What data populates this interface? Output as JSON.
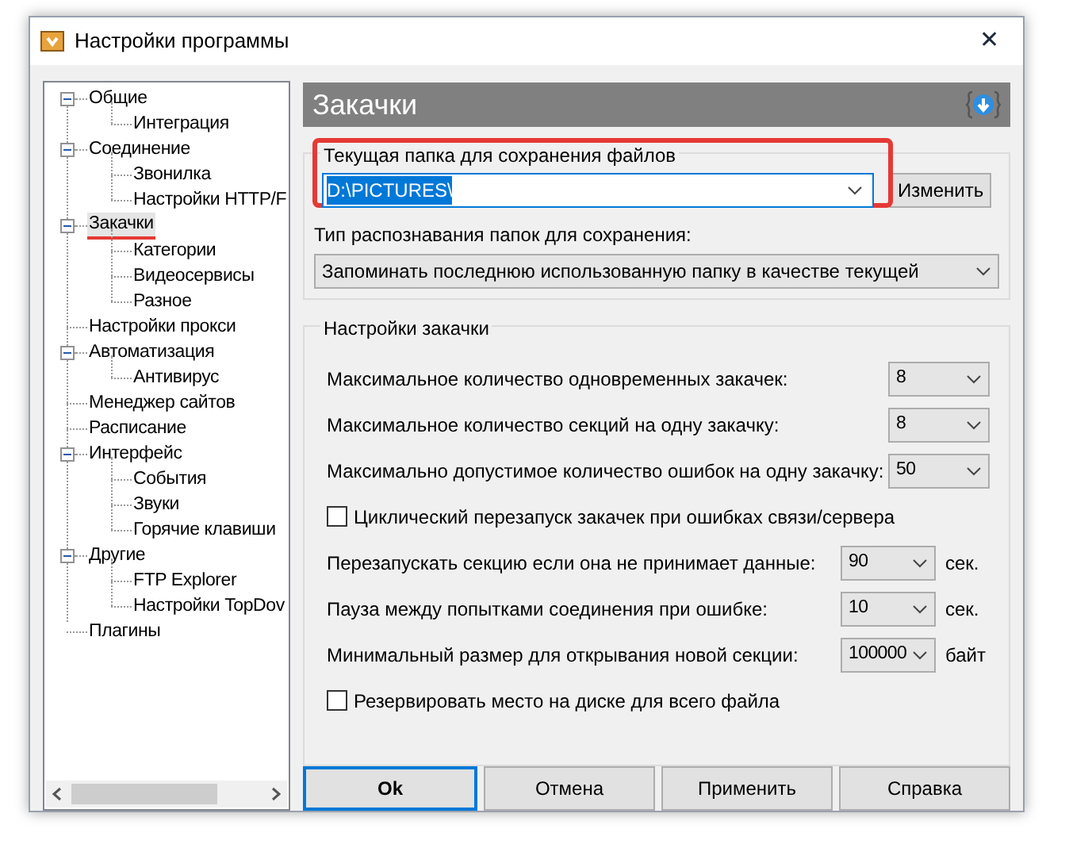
{
  "window": {
    "title": "Настройки программы",
    "close": "✕"
  },
  "tree": [
    {
      "label": "Общие",
      "selected": false,
      "expanded": true,
      "children": [
        {
          "label": "Интеграция",
          "selected": false
        }
      ]
    },
    {
      "label": "Соединение",
      "selected": false,
      "expanded": true,
      "children": [
        {
          "label": "Звонилка",
          "selected": false
        },
        {
          "label": "Настройки HTTP/F",
          "selected": false
        }
      ]
    },
    {
      "label": "Закачки",
      "selected": true,
      "expanded": true,
      "children": [
        {
          "label": "Категории",
          "selected": false
        },
        {
          "label": "Видеосервисы",
          "selected": false
        },
        {
          "label": "Разное",
          "selected": false
        }
      ]
    },
    {
      "label": "Настройки прокси",
      "selected": false
    },
    {
      "label": "Автоматизация",
      "selected": false,
      "expanded": true,
      "children": [
        {
          "label": "Антивирус",
          "selected": false
        }
      ]
    },
    {
      "label": "Менеджер сайтов",
      "selected": false
    },
    {
      "label": "Расписание",
      "selected": false
    },
    {
      "label": "Интерфейс",
      "selected": false,
      "expanded": true,
      "children": [
        {
          "label": "События",
          "selected": false
        },
        {
          "label": "Звуки",
          "selected": false
        },
        {
          "label": "Горячие клавиши",
          "selected": false
        }
      ]
    },
    {
      "label": "Другие",
      "selected": false,
      "expanded": true,
      "children": [
        {
          "label": "FTP Explorer",
          "selected": false
        },
        {
          "label": "Настройки TopDov",
          "selected": false
        }
      ]
    },
    {
      "label": "Плагины",
      "selected": false
    }
  ],
  "header": {
    "title": "Закачки"
  },
  "folder_group": {
    "legend": "Текущая папка для сохранения файлов",
    "value": "D:\\PICTURES\\",
    "button": "Изменить",
    "detect_label": "Тип распознавания папок для сохранения:",
    "detect_value": "Запоминать последнюю использованную папку в качестве текущей"
  },
  "download_group": {
    "legend": "Настройки закачки",
    "rows": [
      {
        "kind": "select",
        "label": "Максимальное количество одновременных закачек:",
        "value": "8"
      },
      {
        "kind": "select",
        "label": "Максимальное количество секций на одну закачку:",
        "value": "8"
      },
      {
        "kind": "select",
        "label": "Максимально допустимое количество ошибок на одну закачку:",
        "value": "50"
      },
      {
        "kind": "checkbox",
        "label": "Циклический перезапуск закачек при ошибках связи/сервера",
        "checked": false
      },
      {
        "kind": "unit_select",
        "label": "Перезапускать секцию если она не принимает данные:",
        "value": "90",
        "unit": "сек."
      },
      {
        "kind": "unit_select",
        "label": "Пауза между попытками соединения при ошибке:",
        "value": "10",
        "unit": "сек."
      },
      {
        "kind": "unit_select",
        "label": "Минимальный размер для открывания новой секции:",
        "value": "100000",
        "unit": "байт"
      },
      {
        "kind": "checkbox",
        "label": "Резервировать место на диске для всего файла",
        "checked": false
      }
    ]
  },
  "buttons": [
    {
      "label": "Ok",
      "default": true
    },
    {
      "label": "Отмена",
      "default": false
    },
    {
      "label": "Применить",
      "default": false
    },
    {
      "label": "Справка",
      "default": false
    }
  ]
}
